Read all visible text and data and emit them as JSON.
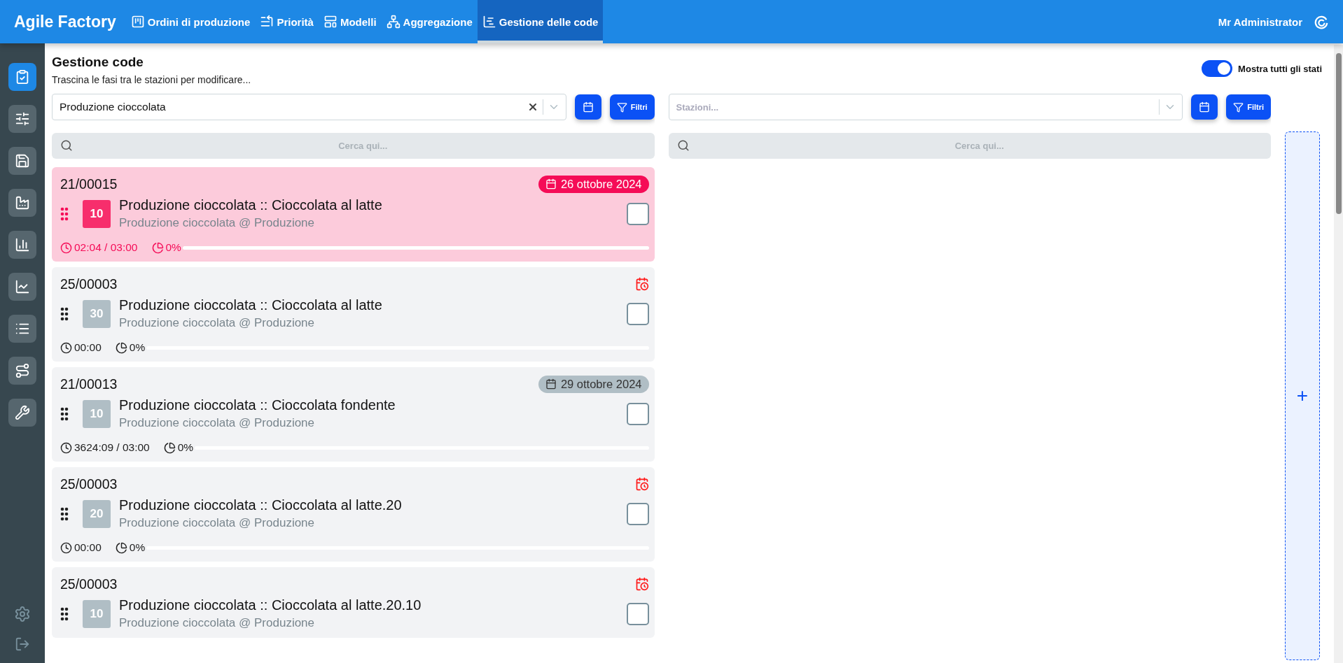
{
  "nav": {
    "brand": "Agile Factory",
    "items": [
      {
        "label": "Ordini di produzione",
        "selected": false
      },
      {
        "label": "Priorità",
        "selected": false
      },
      {
        "label": "Modelli",
        "selected": false
      },
      {
        "label": "Aggregazione",
        "selected": false
      },
      {
        "label": "Gestione delle code",
        "selected": true
      }
    ],
    "user": "Mr Administrator"
  },
  "sidebar": {
    "items": [
      {
        "selected": true
      },
      {
        "selected": false
      },
      {
        "selected": false
      },
      {
        "selected": false
      },
      {
        "selected": false
      },
      {
        "selected": false
      },
      {
        "selected": false
      },
      {
        "selected": false
      },
      {
        "selected": false
      }
    ]
  },
  "header": {
    "title": "Gestione code",
    "subtitle": "Trascina le fasi tra le stazioni per modificare...",
    "toggle": {
      "label": "Mostra tutti gli stati",
      "on": true
    }
  },
  "left": {
    "select": {
      "value": "Produzione cioccolata"
    },
    "filter_button": "Filtri",
    "search": {
      "placeholder": "Cerca qui..."
    },
    "cards": [
      {
        "number": "21/00015",
        "badge": {
          "kind": "date",
          "text": "26 ottobre 2024",
          "color": "#f50c57"
        },
        "highlighted": true,
        "step": "10",
        "title": "Produzione cioccolata :: Cioccolata al latte",
        "subtitle": "Produzione cioccolata @ Produzione",
        "checked": false,
        "time": "02:04 / 03:00",
        "percent": "0%",
        "level": 0
      },
      {
        "number": "25/00003",
        "badge": {
          "kind": "alert"
        },
        "highlighted": false,
        "step": "30",
        "title": "Produzione cioccolata :: Cioccolata al latte",
        "subtitle": "Produzione cioccolata @ Produzione",
        "checked": false,
        "time": "00:00",
        "percent": "0%",
        "level": 0
      },
      {
        "number": "21/00013",
        "badge": {
          "kind": "date",
          "text": "29 ottobre 2024",
          "color": "#b0bec5"
        },
        "highlighted": false,
        "step": "10",
        "title": "Produzione cioccolata :: Cioccolata fondente",
        "subtitle": "Produzione cioccolata @ Produzione",
        "checked": false,
        "time": "3624:09 / 03:00",
        "percent": "0%",
        "level": 0
      },
      {
        "number": "25/00003",
        "badge": {
          "kind": "alert"
        },
        "highlighted": false,
        "step": "20",
        "title": "Produzione cioccolata :: Cioccolata al latte.20",
        "subtitle": "Produzione cioccolata @ Produzione",
        "checked": false,
        "time": "00:00",
        "percent": "0%",
        "level": 0
      },
      {
        "number": "25/00003",
        "badge": {
          "kind": "alert"
        },
        "highlighted": false,
        "step": "10",
        "title": "Produzione cioccolata :: Cioccolata al latte.20.10",
        "subtitle": "Produzione cioccolata @ Produzione",
        "checked": false
      }
    ]
  },
  "right": {
    "select": {
      "placeholder": "Stazioni..."
    },
    "filter_button": "Filtri",
    "search": {
      "placeholder": "Cerca qui..."
    }
  },
  "add_column": {
    "label": "+"
  }
}
